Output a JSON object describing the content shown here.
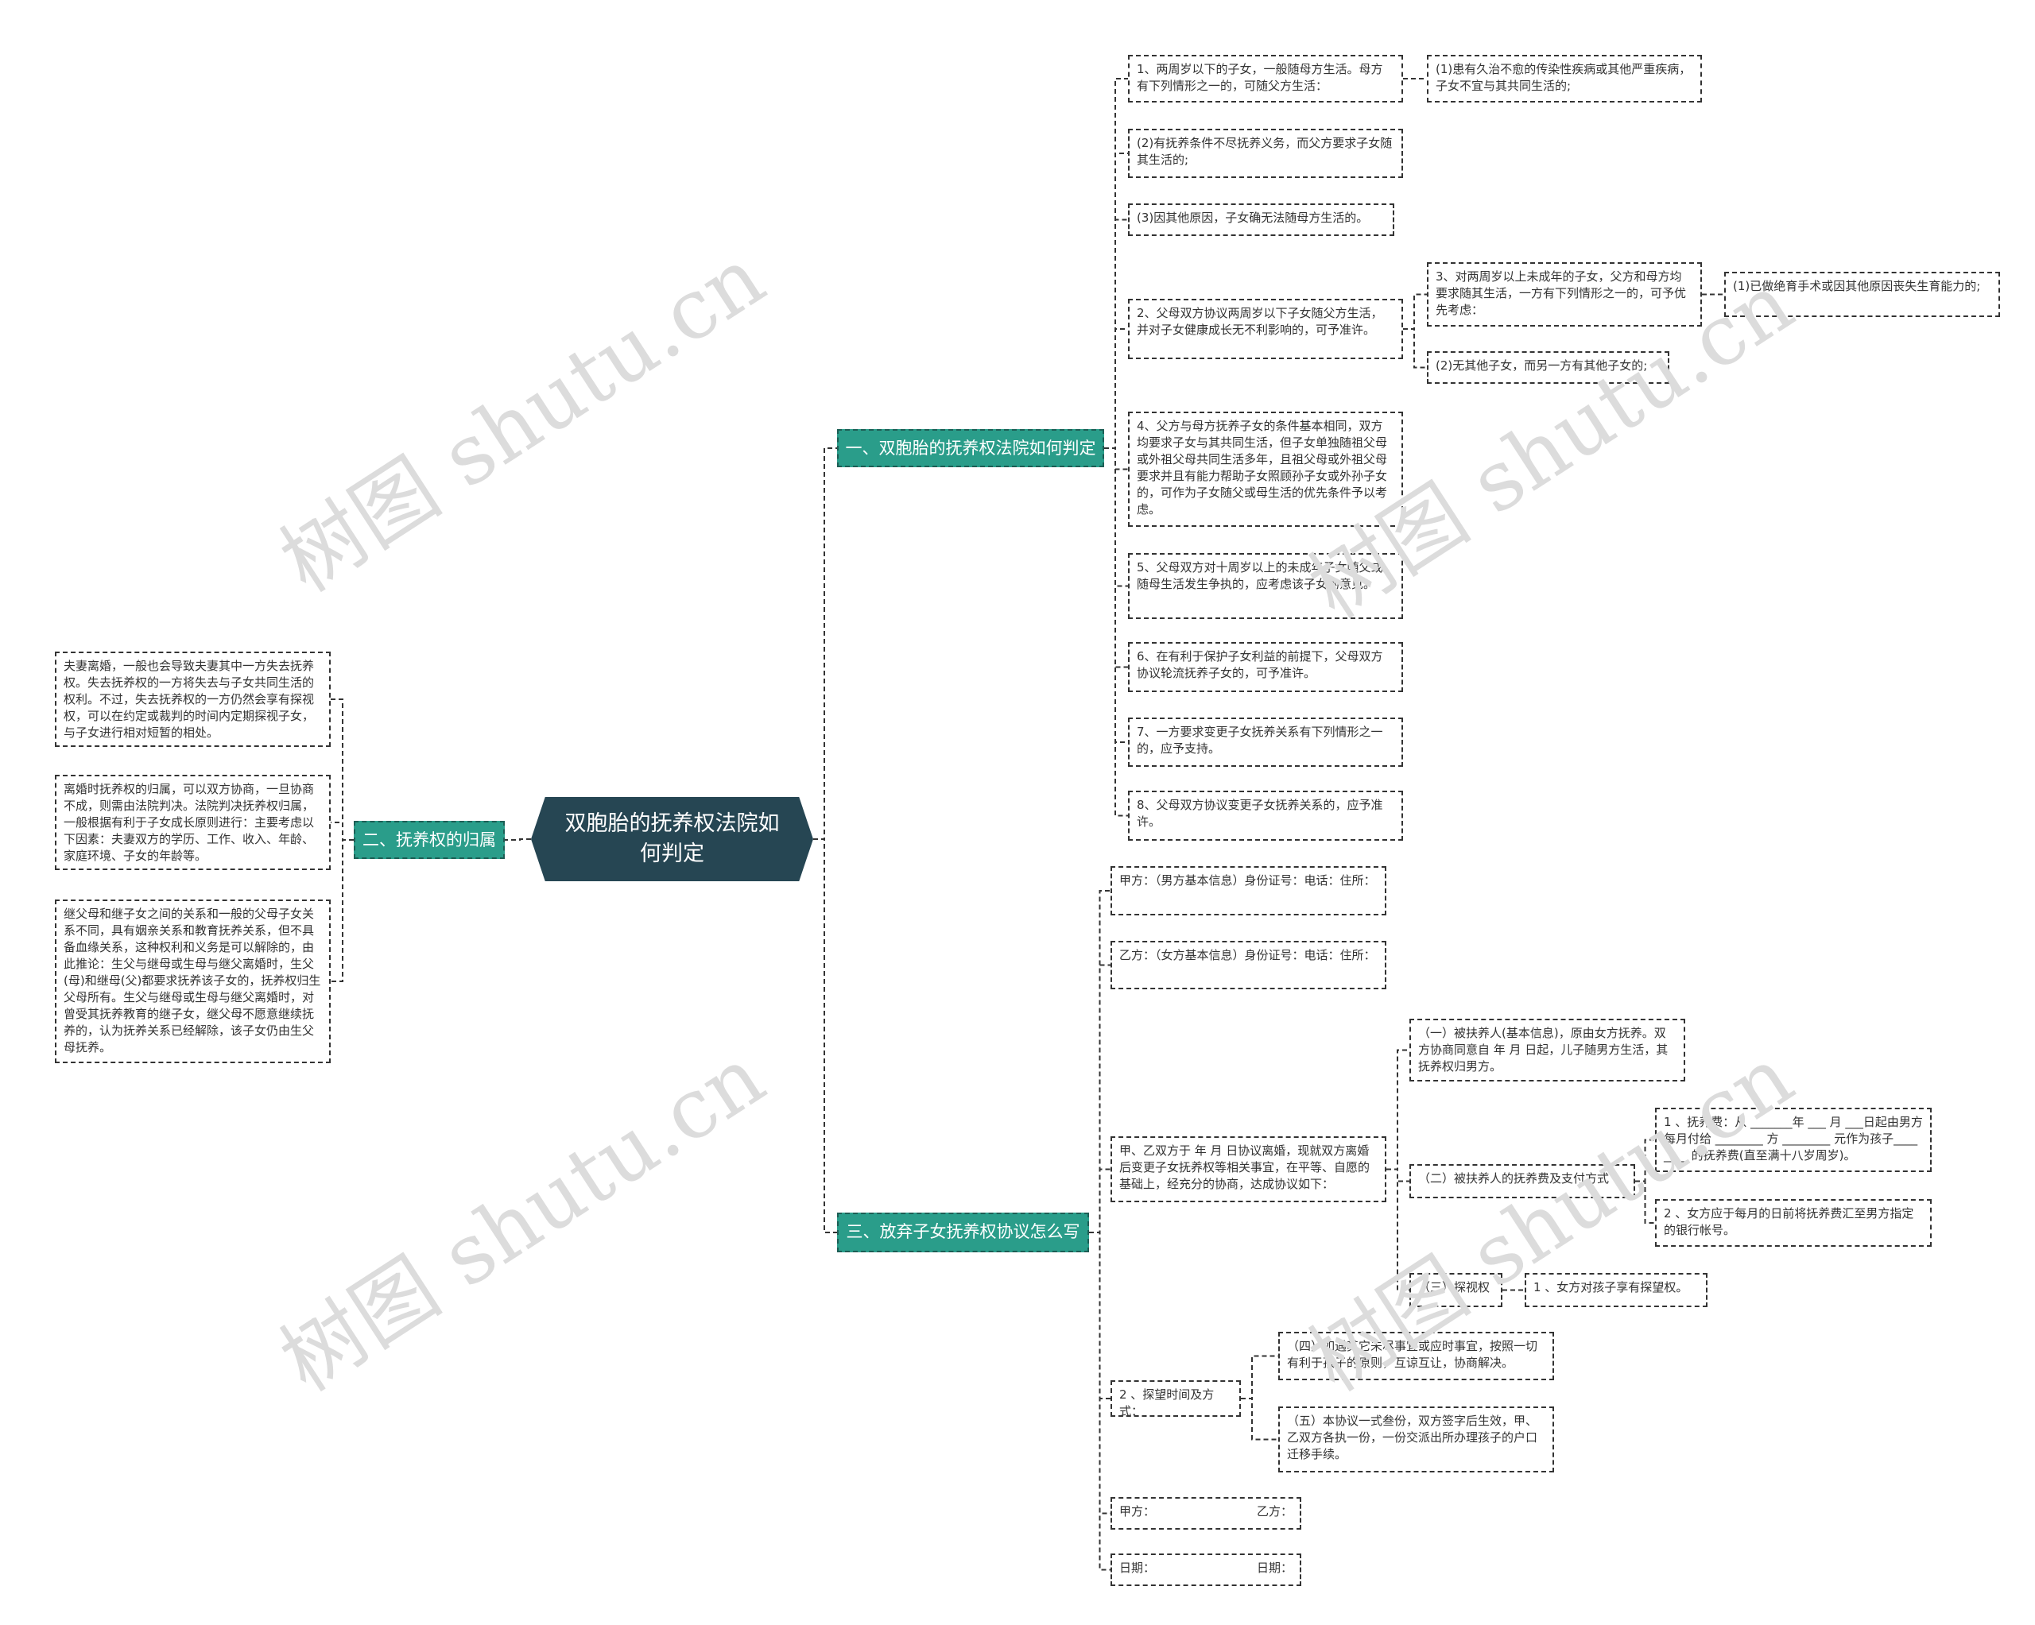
{
  "root": {
    "title": "双胞胎的抚养权法院如何判定"
  },
  "watermark": "树图 shutu.cn",
  "colors": {
    "root": "#264653",
    "branch": "#2a9d8a",
    "line": "#333333"
  },
  "branch1": {
    "label": "一、双胞胎的抚养权法院如何判定",
    "items": [
      "1、两周岁以下的子女，一般随母方生活。母方有下列情形之一的，可随父方生活：",
      "(2)有抚养条件不尽抚养义务，而父方要求子女随其生活的;",
      "(3)因其他原因，子女确无法随母方生活的。",
      "2、父母双方协议两周岁以下子女随父方生活，并对子女健康成长无不利影响的，可予准许。",
      "4、父方与母方抚养子女的条件基本相同，双方均要求子女与其共同生活，但子女单独随祖父母或外祖父母共同生活多年，且祖父母或外祖父母要求并且有能力帮助子女照顾孙子女或外孙子女的，可作为子女随父或母生活的优先条件予以考虑。",
      "5、父母双方对十周岁以上的未成年子女随父或随母生活发生争执的，应考虑该子女的意见。",
      "6、在有利于保护子女利益的前提下，父母双方协议轮流抚养子女的，可予准许。",
      "7、一方要求变更子女抚养关系有下列情形之一的，应予支持。",
      "8、父母双方协议变更子女抚养关系的，应予准许。"
    ],
    "item1_child": "(1)患有久治不愈的传染性疾病或其他严重疾病，子女不宜与其共同生活的;",
    "item2_children": [
      "3、对两周岁以上未成年的子女，父方和母方均要求随其生活，一方有下列情形之一的，可予优先考虑：",
      "(2)无其他子女，而另一方有其他子女的;"
    ],
    "item3_child": "(1)已做绝育手术或因其他原因丧失生育能力的;"
  },
  "branch2": {
    "label": "二、抚养权的归属",
    "items": [
      "夫妻离婚，一般也会导致夫妻其中一方失去抚养权。失去抚养权的一方将失去与子女共同生活的权利。不过，失去抚养权的一方仍然会享有探视权，可以在约定或裁判的时间内定期探视子女，与子女进行相对短暂的相处。",
      "离婚时抚养权的归属，可以双方协商，一旦协商不成，则需由法院判决。法院判决抚养权归属，一般根据有利于子女成长原则进行：主要考虑以下因素：夫妻双方的学历、工作、收入、年龄、家庭环境、子女的年龄等。",
      "继父母和继子女之间的关系和一般的父母子女关系不同，具有姻亲关系和教育抚养关系，但不具备血缘关系，这种权利和义务是可以解除的，由此推论：生父与继母或生母与继父离婚时，生父(母)和继母(父)都要求抚养该子女的，抚养权归生父母所有。生父与继母或生母与继父离婚时，对曾受其抚养教育的继子女，继父母不愿意继续抚养的，认为抚养关系已经解除，该子女仍由生父母抚养。"
    ]
  },
  "branch3": {
    "label": "三、放弃子女抚养权协议怎么写",
    "party_a": "甲方：（男方基本信息）身份证号：电话：住所：",
    "party_b": "乙方：（女方基本信息）身份证号：电话：住所：",
    "agreement": "甲、乙双方于 年 月 日协议离婚，现就双方离婚后变更子女抚养权等相关事宜，在平等、自愿的基础上，经充分的协商，达成协议如下：",
    "clauses": {
      "one": "（一）被扶养人(基本信息)，原由女方抚养。双方协商同意自 年 月 日起，儿子随男方生活，其抚养权归男方。",
      "two": "（二）被扶养人的抚养费及支付方式",
      "two_items": [
        "1 、抚养费：从 _______年 ___ 月 ___日起由男方每月付给 ________ 方 ________ 元作为孩子________ 的抚养费(直至满十八岁周岁)。",
        "2 、女方应于每月的日前将抚养费汇至男方指定的银行帐号。"
      ],
      "three": "（三）探视权",
      "three_item": "1 、女方对孩子享有探望权。"
    },
    "visit": "2 、探望时间及方式：",
    "visit_items": [
      "（四）如遇其它未尽事宜或应时事宜，按照一切有利于孩子的原则，互谅互让，协商解决。",
      "（五）本协议一式叁份，双方签字后生效，甲、乙双方各执一份，一份交派出所办理孩子的户口迁移手续。"
    ],
    "sign": {
      "a": "甲方：",
      "b": "乙方："
    },
    "date": {
      "a": "日期：",
      "b": "日期："
    }
  }
}
